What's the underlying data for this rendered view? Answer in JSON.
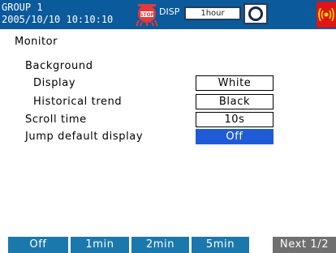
{
  "status": {
    "group": "GROUP 1",
    "datetime": "2005/10/10 10:10:10",
    "disp_label": "DISP",
    "time_div": "1hour",
    "brand_color": "#0a5a9c",
    "alarm_color": "#e01515",
    "stop_icon": "stop-status-icon",
    "snapshot_icon": "snapshot-icon",
    "alarm_icon": "alarm-indicator-icon"
  },
  "main": {
    "title": "Monitor",
    "background_heading": "Background",
    "rows": [
      {
        "label": "Display",
        "value": "White"
      },
      {
        "label": "Historical trend",
        "value": "Black"
      },
      {
        "label": "Scroll time",
        "value": "10s"
      },
      {
        "label": "Jump default display",
        "value": "Off",
        "selected": true
      }
    ],
    "selected_color": "#1f5bd6"
  },
  "softkeys": [
    {
      "label": "Off"
    },
    {
      "label": "1min"
    },
    {
      "label": "2min"
    },
    {
      "label": "5min"
    },
    {
      "label": "Next 1/2"
    }
  ],
  "softkey_color": "#1b78ac",
  "softkey_next_color": "#707070"
}
